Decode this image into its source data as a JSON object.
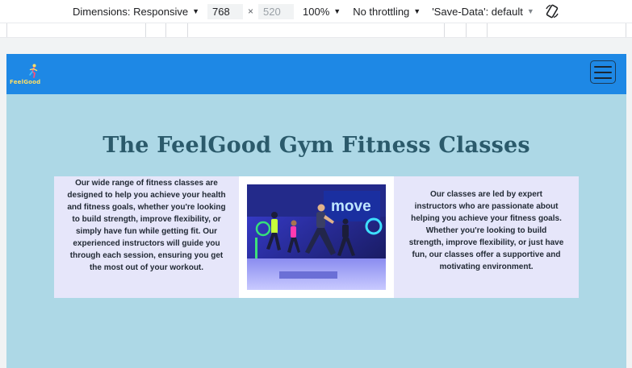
{
  "devtools": {
    "dimensions_label": "Dimensions: Responsive",
    "width_value": "768",
    "times": "×",
    "height_placeholder": "520",
    "zoom": "100%",
    "throttling": "No throttling",
    "save_data": "'Save-Data': default"
  },
  "page": {
    "brand": "FeelGood",
    "heading": "The FeelGood Gym Fitness Classes",
    "left_text": "Our wide range of fitness classes are designed to help you achieve your health and fitness goals, whether you're looking to build strength, improve flexibility, or simply have fun while getting fit. Our experienced instructors will guide you through each session, ensuring you get the most out of your workout.",
    "right_text": "Our classes are led by expert instructors who are passionate about helping you achieve your fitness goals. Whether you're looking to build strength, improve flexibility, or just have fun, our classes offer a supportive and motivating environment.",
    "photo_sign": "move"
  },
  "colors": {
    "navbar": "#1e88e5",
    "page_bg": "#add8e6",
    "panel_bg": "#e6e6fa",
    "heading": "#2b5a6b"
  }
}
